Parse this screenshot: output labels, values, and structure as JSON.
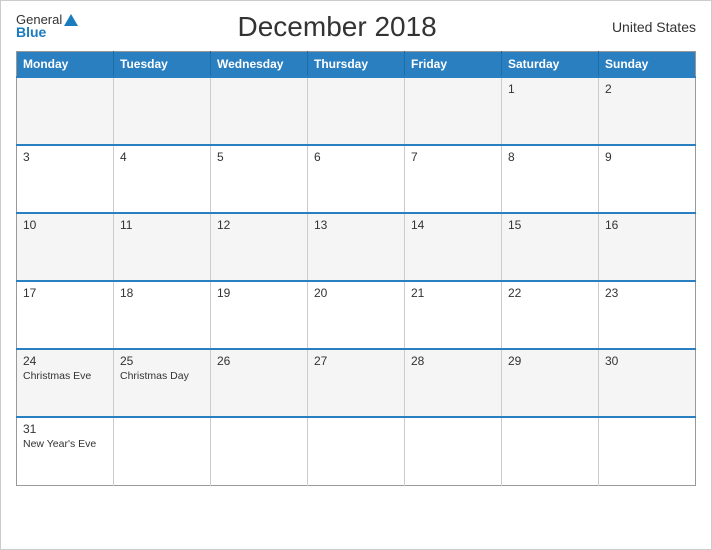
{
  "header": {
    "logo_general": "General",
    "logo_blue": "Blue",
    "title": "December 2018",
    "country": "United States"
  },
  "weekdays": [
    "Monday",
    "Tuesday",
    "Wednesday",
    "Thursday",
    "Friday",
    "Saturday",
    "Sunday"
  ],
  "rows": [
    [
      {
        "day": "",
        "event": ""
      },
      {
        "day": "",
        "event": ""
      },
      {
        "day": "",
        "event": ""
      },
      {
        "day": "",
        "event": ""
      },
      {
        "day": "",
        "event": ""
      },
      {
        "day": "1",
        "event": ""
      },
      {
        "day": "2",
        "event": ""
      }
    ],
    [
      {
        "day": "3",
        "event": ""
      },
      {
        "day": "4",
        "event": ""
      },
      {
        "day": "5",
        "event": ""
      },
      {
        "day": "6",
        "event": ""
      },
      {
        "day": "7",
        "event": ""
      },
      {
        "day": "8",
        "event": ""
      },
      {
        "day": "9",
        "event": ""
      }
    ],
    [
      {
        "day": "10",
        "event": ""
      },
      {
        "day": "11",
        "event": ""
      },
      {
        "day": "12",
        "event": ""
      },
      {
        "day": "13",
        "event": ""
      },
      {
        "day": "14",
        "event": ""
      },
      {
        "day": "15",
        "event": ""
      },
      {
        "day": "16",
        "event": ""
      }
    ],
    [
      {
        "day": "17",
        "event": ""
      },
      {
        "day": "18",
        "event": ""
      },
      {
        "day": "19",
        "event": ""
      },
      {
        "day": "20",
        "event": ""
      },
      {
        "day": "21",
        "event": ""
      },
      {
        "day": "22",
        "event": ""
      },
      {
        "day": "23",
        "event": ""
      }
    ],
    [
      {
        "day": "24",
        "event": "Christmas Eve"
      },
      {
        "day": "25",
        "event": "Christmas Day"
      },
      {
        "day": "26",
        "event": ""
      },
      {
        "day": "27",
        "event": ""
      },
      {
        "day": "28",
        "event": ""
      },
      {
        "day": "29",
        "event": ""
      },
      {
        "day": "30",
        "event": ""
      }
    ],
    [
      {
        "day": "31",
        "event": "New Year's Eve"
      },
      {
        "day": "",
        "event": ""
      },
      {
        "day": "",
        "event": ""
      },
      {
        "day": "",
        "event": ""
      },
      {
        "day": "",
        "event": ""
      },
      {
        "day": "",
        "event": ""
      },
      {
        "day": "",
        "event": ""
      }
    ]
  ]
}
